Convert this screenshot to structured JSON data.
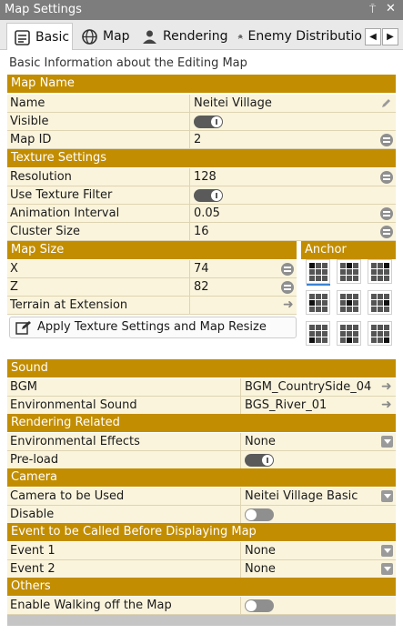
{
  "window": {
    "title": "Map Settings",
    "pin_glyph": "⍑",
    "close_glyph": "✕"
  },
  "tabs": [
    {
      "label": "Basic",
      "icon": "basic-settings-icon"
    },
    {
      "label": "Map",
      "icon": "map-globe-icon"
    },
    {
      "label": "Rendering",
      "icon": "rendering-icon"
    },
    {
      "label": "Enemy Distributio",
      "icon": "enemy-icon"
    }
  ],
  "tab_scroll": {
    "left": "◀",
    "right": "▶"
  },
  "intro": "Basic Information about the Editing Map",
  "map_name": {
    "header": "Map Name",
    "name_label": "Name",
    "name_value": "Neitei Village",
    "visible_label": "Visible",
    "visible_on": true,
    "id_label": "Map ID",
    "id_value": "2"
  },
  "texture": {
    "header": "Texture Settings",
    "resolution_label": "Resolution",
    "resolution_value": "128",
    "filter_label": "Use Texture Filter",
    "filter_on": true,
    "interval_label": "Animation Interval",
    "interval_value": "0.05",
    "cluster_label": "Cluster Size",
    "cluster_value": "16"
  },
  "map_size": {
    "header": "Map Size",
    "x_label": "X",
    "x_value": "74",
    "z_label": "Z",
    "z_value": "82",
    "terrain_label": "Terrain at Extension",
    "apply_label": "Apply Texture Settings and Map Resize"
  },
  "anchor": {
    "header": "Anchor",
    "selected": "top-left"
  },
  "sound": {
    "header": "Sound",
    "bgm_label": "BGM",
    "bgm_value": "BGM_CountrySide_04",
    "env_label": "Environmental Sound",
    "env_value": "BGS_River_01"
  },
  "rendering": {
    "header": "Rendering Related",
    "effects_label": "Environmental Effects",
    "effects_value": "None",
    "preload_label": "Pre-load",
    "preload_on": true
  },
  "camera": {
    "header": "Camera",
    "use_label": "Camera to be Used",
    "use_value": "Neitei Village Basic",
    "disable_label": "Disable",
    "disable_on": false
  },
  "event": {
    "header": "Event to be Called Before Displaying Map",
    "e1_label": "Event 1",
    "e1_value": "None",
    "e2_label": "Event 2",
    "e2_value": "None"
  },
  "others": {
    "header": "Others",
    "walk_label": "Enable Walking off the Map",
    "walk_on": false
  },
  "colors": {
    "section": "#c28d00",
    "row": "#faf4dc",
    "accent": "#3c83d2"
  }
}
